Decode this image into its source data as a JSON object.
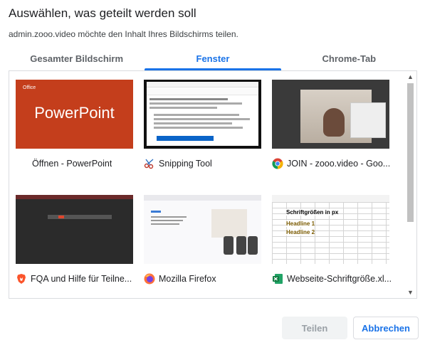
{
  "dialog": {
    "title": "Auswählen, was geteilt werden soll",
    "subtitle": "admin.zooo.video möchte den Inhalt Ihres Bildschirms teilen."
  },
  "tabs": [
    {
      "label": "Gesamter Bildschirm",
      "active": false
    },
    {
      "label": "Fenster",
      "active": true
    },
    {
      "label": "Chrome-Tab",
      "active": false
    }
  ],
  "windows": [
    {
      "caption": "Öffnen - PowerPoint",
      "icon": "none",
      "thumb_text": "PowerPoint",
      "thumb_logo": "Office"
    },
    {
      "caption": "Snipping Tool",
      "icon": "snipping-tool-icon"
    },
    {
      "caption": "JOIN - zooo.video - Goo...",
      "icon": "chrome-icon"
    },
    {
      "caption": "FQA und Hilfe für Teilne...",
      "icon": "brave-icon"
    },
    {
      "caption": "Mozilla Firefox",
      "icon": "firefox-icon"
    },
    {
      "caption": "Webseite-Schriftgröße.xl...",
      "icon": "excel-icon",
      "thumb_lines": [
        "Schriftgrößen in px",
        "Headline 1",
        "Headline 2"
      ]
    }
  ],
  "buttons": {
    "share": "Teilen",
    "cancel": "Abbrechen"
  },
  "colors": {
    "accent": "#1a73e8",
    "powerpoint": "#c43e1c"
  }
}
